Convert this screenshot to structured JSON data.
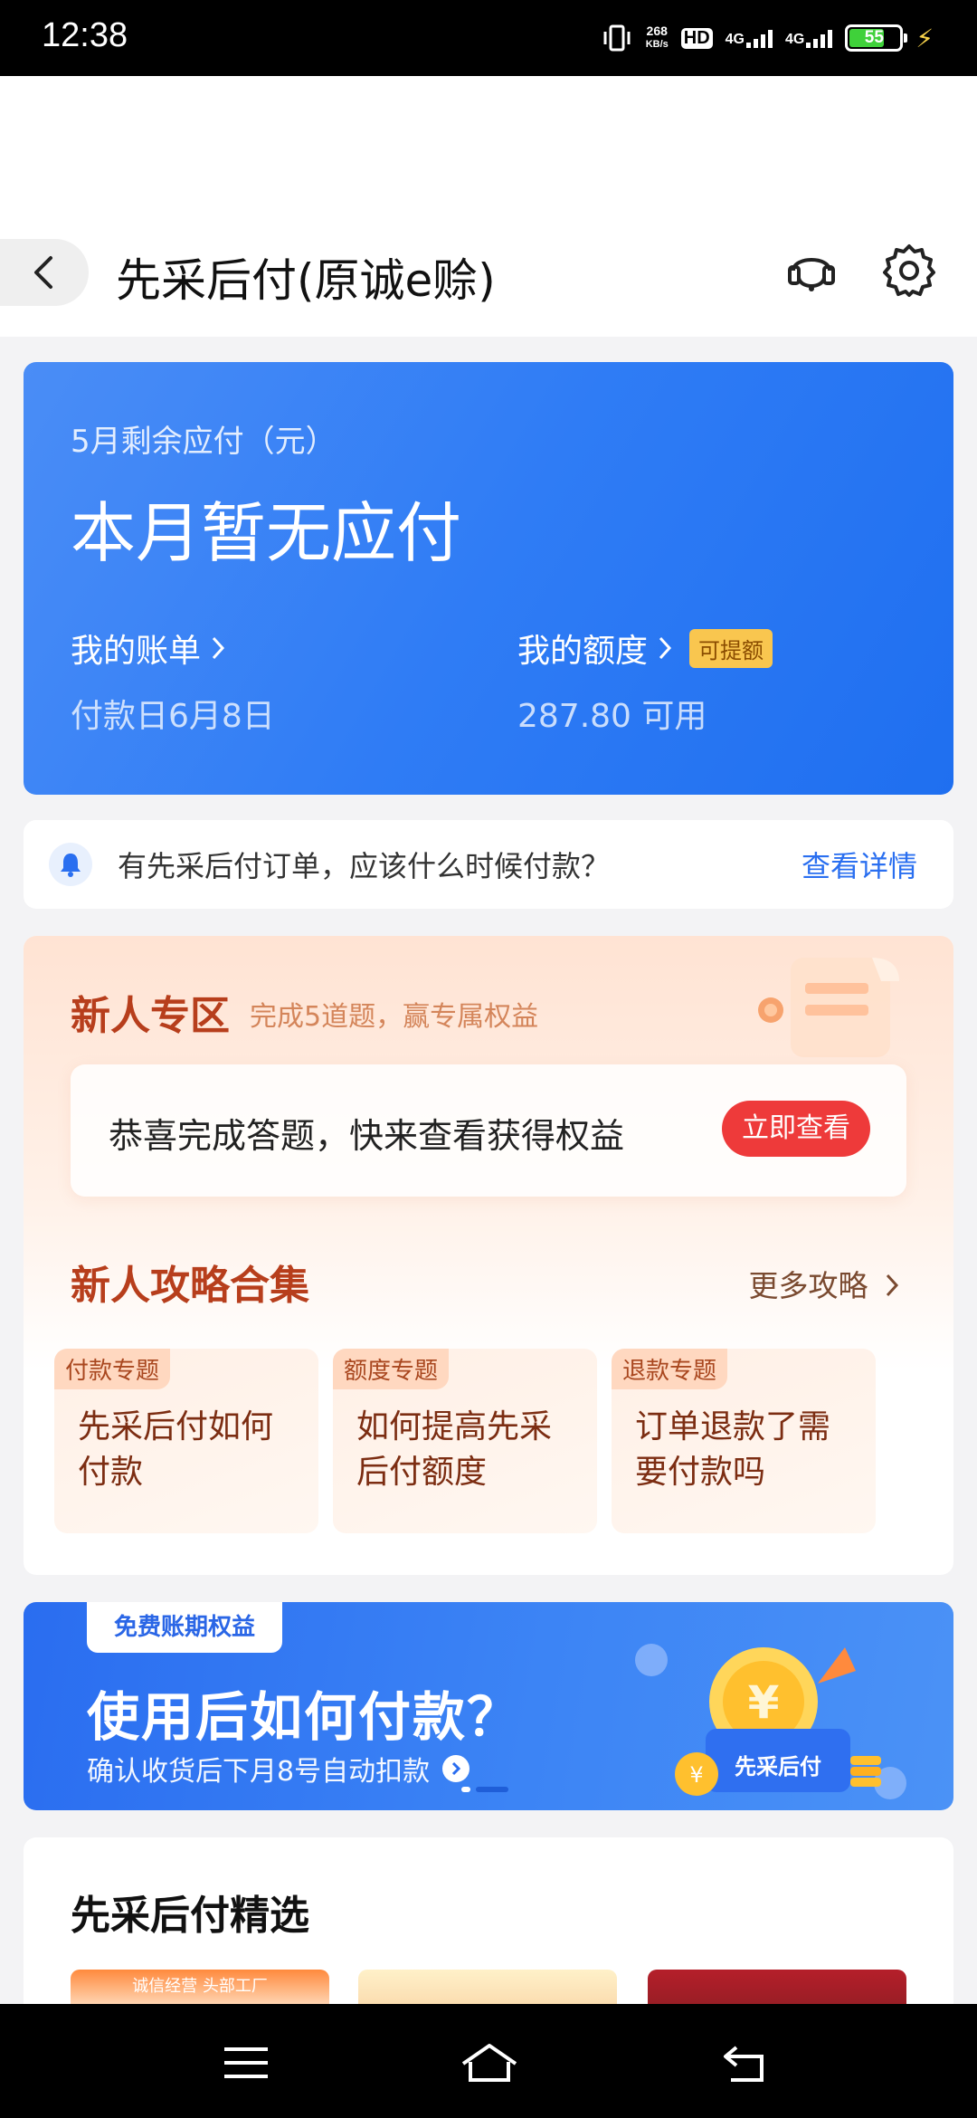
{
  "status_bar": {
    "time": "12:38",
    "net_speed_value": "268",
    "net_speed_unit": "KB/s",
    "hd_label": "HD",
    "sim1_label": "4G",
    "sim2_label": "4G",
    "battery": "55"
  },
  "header": {
    "title": "先采后付(原诚e赊)",
    "back_icon": "chevron-left-icon",
    "service_icon": "customer-service-icon",
    "settings_icon": "gear-icon"
  },
  "bill": {
    "label": "5月剩余应付（元）",
    "amount": "本月暂无应付",
    "my_bill": "我的账单",
    "due_date": "付款日6月8日",
    "my_limit": "我的额度",
    "limit_tag": "可提额",
    "available": "287.80 可用"
  },
  "notice": {
    "text": "有先采后付订单，应该什么时候付款？",
    "link": "查看详情"
  },
  "newbie": {
    "zone_title": "新人专区",
    "zone_sub": "完成5道题，赢专属权益",
    "congrats_text": "恭喜完成答题，快来查看获得权益",
    "congrats_button": "立即查看",
    "guide_title": "新人攻略合集",
    "more_link": "更多攻略",
    "guides": [
      {
        "tag": "付款专题",
        "text": "先采后付如何付款"
      },
      {
        "tag": "额度专题",
        "text": "如何提高先采后付额度"
      },
      {
        "tag": "退款专题",
        "text": "订单退款了需要付款吗"
      }
    ]
  },
  "banner": {
    "tag": "免费账期权益",
    "title": "使用后如何付款？",
    "subtitle": "确认收货后下月8号自动扣款",
    "illustration_label": "先采后付"
  },
  "selection": {
    "title": "先采后付精选",
    "product1_badge": "诚信经营 头部工厂"
  },
  "colors": {
    "primary_blue": "#2f7cf5",
    "accent_red": "#ee3a3a",
    "zone_title": "#b73e1c",
    "link_blue": "#2a6ff0"
  }
}
